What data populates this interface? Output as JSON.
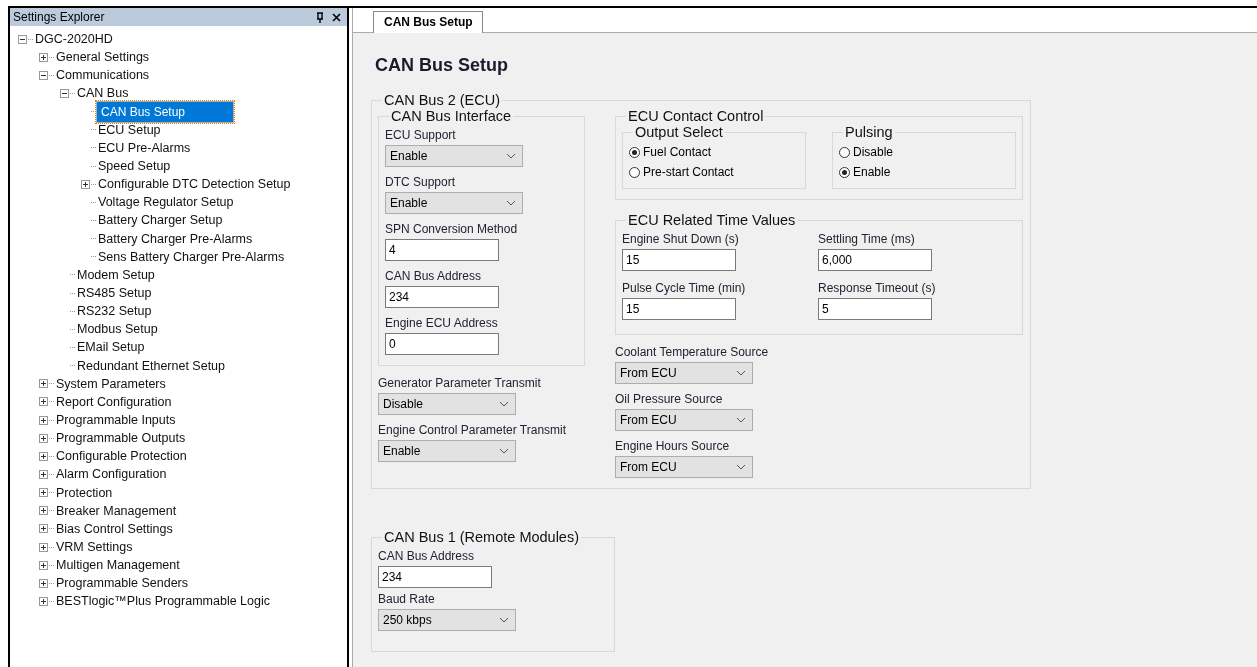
{
  "explorer": {
    "title": "Settings Explorer"
  },
  "tree": [
    {
      "label": "DGC-2020HD",
      "expanded": true,
      "selected": false,
      "children": [
        {
          "label": "General Settings",
          "expanded": false,
          "selected": false
        },
        {
          "label": "Communications",
          "expanded": true,
          "selected": false,
          "children": [
            {
              "label": "CAN Bus",
              "expanded": true,
              "selected": false,
              "children": [
                {
                  "label": "CAN Bus Setup",
                  "selected": true
                },
                {
                  "label": "ECU Setup",
                  "selected": false
                },
                {
                  "label": "ECU Pre-Alarms",
                  "selected": false
                },
                {
                  "label": "Speed Setup",
                  "selected": false
                },
                {
                  "label": "Configurable DTC Detection Setup",
                  "expanded": false,
                  "selected": false
                },
                {
                  "label": "Voltage Regulator Setup",
                  "selected": false
                },
                {
                  "label": "Battery Charger Setup",
                  "selected": false
                },
                {
                  "label": "Battery Charger Pre-Alarms",
                  "selected": false
                },
                {
                  "label": "Sens Battery Charger Pre-Alarms",
                  "selected": false
                }
              ]
            },
            {
              "label": "Modem Setup",
              "selected": false
            },
            {
              "label": "RS485 Setup",
              "selected": false
            },
            {
              "label": "RS232 Setup",
              "selected": false
            },
            {
              "label": "Modbus Setup",
              "selected": false
            },
            {
              "label": "EMail Setup",
              "selected": false
            },
            {
              "label": "Redundant Ethernet Setup",
              "selected": false
            }
          ]
        },
        {
          "label": "System Parameters",
          "expanded": false,
          "selected": false
        },
        {
          "label": "Report Configuration",
          "expanded": false,
          "selected": false
        },
        {
          "label": "Programmable Inputs",
          "expanded": false,
          "selected": false
        },
        {
          "label": "Programmable Outputs",
          "expanded": false,
          "selected": false
        },
        {
          "label": "Configurable Protection",
          "expanded": false,
          "selected": false
        },
        {
          "label": "Alarm Configuration",
          "expanded": false,
          "selected": false
        },
        {
          "label": "Protection",
          "expanded": false,
          "selected": false
        },
        {
          "label": "Breaker Management",
          "expanded": false,
          "selected": false
        },
        {
          "label": "Bias Control Settings",
          "expanded": false,
          "selected": false
        },
        {
          "label": "VRM Settings",
          "expanded": false,
          "selected": false
        },
        {
          "label": "Multigen Management",
          "expanded": false,
          "selected": false
        },
        {
          "label": "Programmable Senders",
          "expanded": false,
          "selected": false
        },
        {
          "label": "BESTlogic™Plus Programmable Logic",
          "expanded": false,
          "selected": false
        }
      ]
    }
  ],
  "tabs": [
    {
      "label": "CAN Bus Setup",
      "selected": true
    }
  ],
  "page_title": "CAN Bus Setup",
  "can_bus_2": {
    "legend": "CAN Bus 2 (ECU)",
    "interface": {
      "legend": "CAN Bus Interface",
      "fields": [
        {
          "kind": "select",
          "label": "ECU Support",
          "value": "Enable"
        },
        {
          "kind": "select",
          "label": "DTC Support",
          "value": "Enable"
        },
        {
          "kind": "text",
          "label": "SPN Conversion Method",
          "value": "4"
        },
        {
          "kind": "text",
          "label": "CAN Bus Address",
          "value": "234"
        },
        {
          "kind": "text",
          "label": "Engine ECU Address",
          "value": "0"
        }
      ]
    },
    "transmit_fields": [
      {
        "kind": "select",
        "label": "Generator Parameter Transmit",
        "value": "Disable"
      },
      {
        "kind": "select",
        "label": "Engine Control Parameter Transmit",
        "value": "Enable"
      }
    ],
    "contact_control": {
      "legend": "ECU Contact Control",
      "output_select": {
        "legend": "Output Select",
        "options": [
          {
            "label": "Fuel Contact",
            "selected": true
          },
          {
            "label": "Pre-start Contact",
            "selected": false
          }
        ]
      },
      "pulsing": {
        "legend": "Pulsing",
        "options": [
          {
            "label": "Disable",
            "selected": false
          },
          {
            "label": "Enable",
            "selected": true
          }
        ]
      }
    },
    "time_values": {
      "legend": "ECU Related Time Values",
      "fields": [
        {
          "kind": "text",
          "label": "Engine Shut Down (s)",
          "value": "15"
        },
        {
          "kind": "text",
          "label": "Settling Time (ms)",
          "value": "6,000"
        },
        {
          "kind": "text",
          "label": "Pulse Cycle Time (min)",
          "value": "15"
        },
        {
          "kind": "text",
          "label": "Response Timeout (s)",
          "value": "5"
        }
      ]
    },
    "source_fields": [
      {
        "kind": "select",
        "label": "Coolant Temperature Source",
        "value": "From ECU"
      },
      {
        "kind": "select",
        "label": "Oil Pressure Source",
        "value": "From ECU"
      },
      {
        "kind": "select",
        "label": "Engine Hours Source",
        "value": "From ECU"
      }
    ]
  },
  "can_bus_1": {
    "legend": "CAN Bus 1 (Remote Modules)",
    "fields": [
      {
        "kind": "text",
        "label": "CAN Bus Address",
        "value": "234"
      },
      {
        "kind": "select",
        "label": "Baud Rate",
        "value": "250 kbps"
      }
    ]
  }
}
